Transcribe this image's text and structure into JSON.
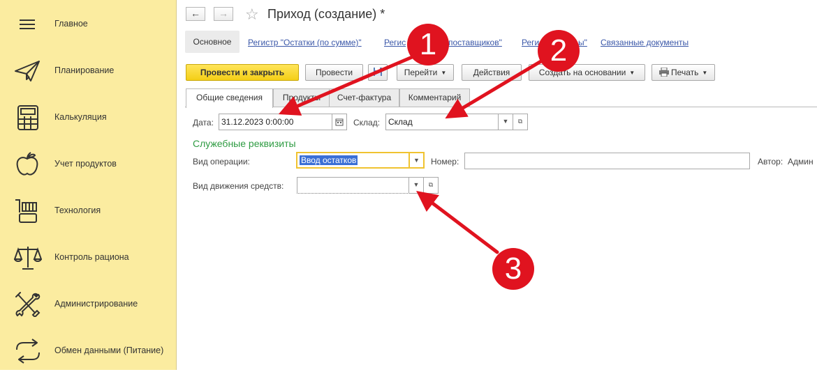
{
  "sidebar": {
    "items": [
      {
        "label": "Главное",
        "icon": "menu-icon"
      },
      {
        "label": "Планирование",
        "icon": "paper-plane-icon"
      },
      {
        "label": "Калькуляция",
        "icon": "calculator-icon"
      },
      {
        "label": "Учет продуктов",
        "icon": "apple-icon"
      },
      {
        "label": "Технология",
        "icon": "cart-icon"
      },
      {
        "label": "Контроль рациона",
        "icon": "scales-icon"
      },
      {
        "label": "Администрирование",
        "icon": "tools-icon"
      },
      {
        "label": "Обмен данными (Питание)",
        "icon": "exchange-arrows-icon"
      }
    ]
  },
  "header": {
    "back": "←",
    "forward": "→",
    "star": "☆",
    "title": "Приход (создание) *"
  },
  "link_tabs": {
    "main": "Основное",
    "reg_balances": "Регистр \"Остатки (по сумме)\"",
    "reg_suppliers_pre": "Регис",
    "reg_suppliers_post": "поставщиков\"",
    "reg3_pre": "Регис",
    "reg3_post": "ы\"",
    "related": "Связанные документы"
  },
  "toolbar": {
    "post_close": "Провести и закрыть",
    "post": "Провести",
    "goto": "Перейти",
    "actions": "Действия",
    "create_based": "Создать на основании",
    "print": "Печать"
  },
  "tabs": {
    "general": "Общие сведения",
    "products": "Продукты",
    "invoice": "Счет-фактура",
    "comment": "Комментарий"
  },
  "form": {
    "date_label": "Дата:",
    "date_value": "31.12.2023  0:00:00",
    "warehouse_label": "Склад:",
    "warehouse_value": "Склад",
    "section_title": "Служебные реквизиты",
    "op_type_label": "Вид операции:",
    "op_type_value": "Ввод остатков",
    "number_label": "Номер:",
    "number_value": "",
    "author_label": "Автор:",
    "author_value": "Админ",
    "cash_flow_label": "Вид движения средств:",
    "cash_flow_value": ""
  },
  "annotations": {
    "m1": "1",
    "m2": "2",
    "m3": "3"
  },
  "colors": {
    "sidebar_bg": "#fbeca0",
    "primary_button": "#f4cf16",
    "annotation_red": "#e0131f",
    "section_green": "#2e9b42"
  }
}
